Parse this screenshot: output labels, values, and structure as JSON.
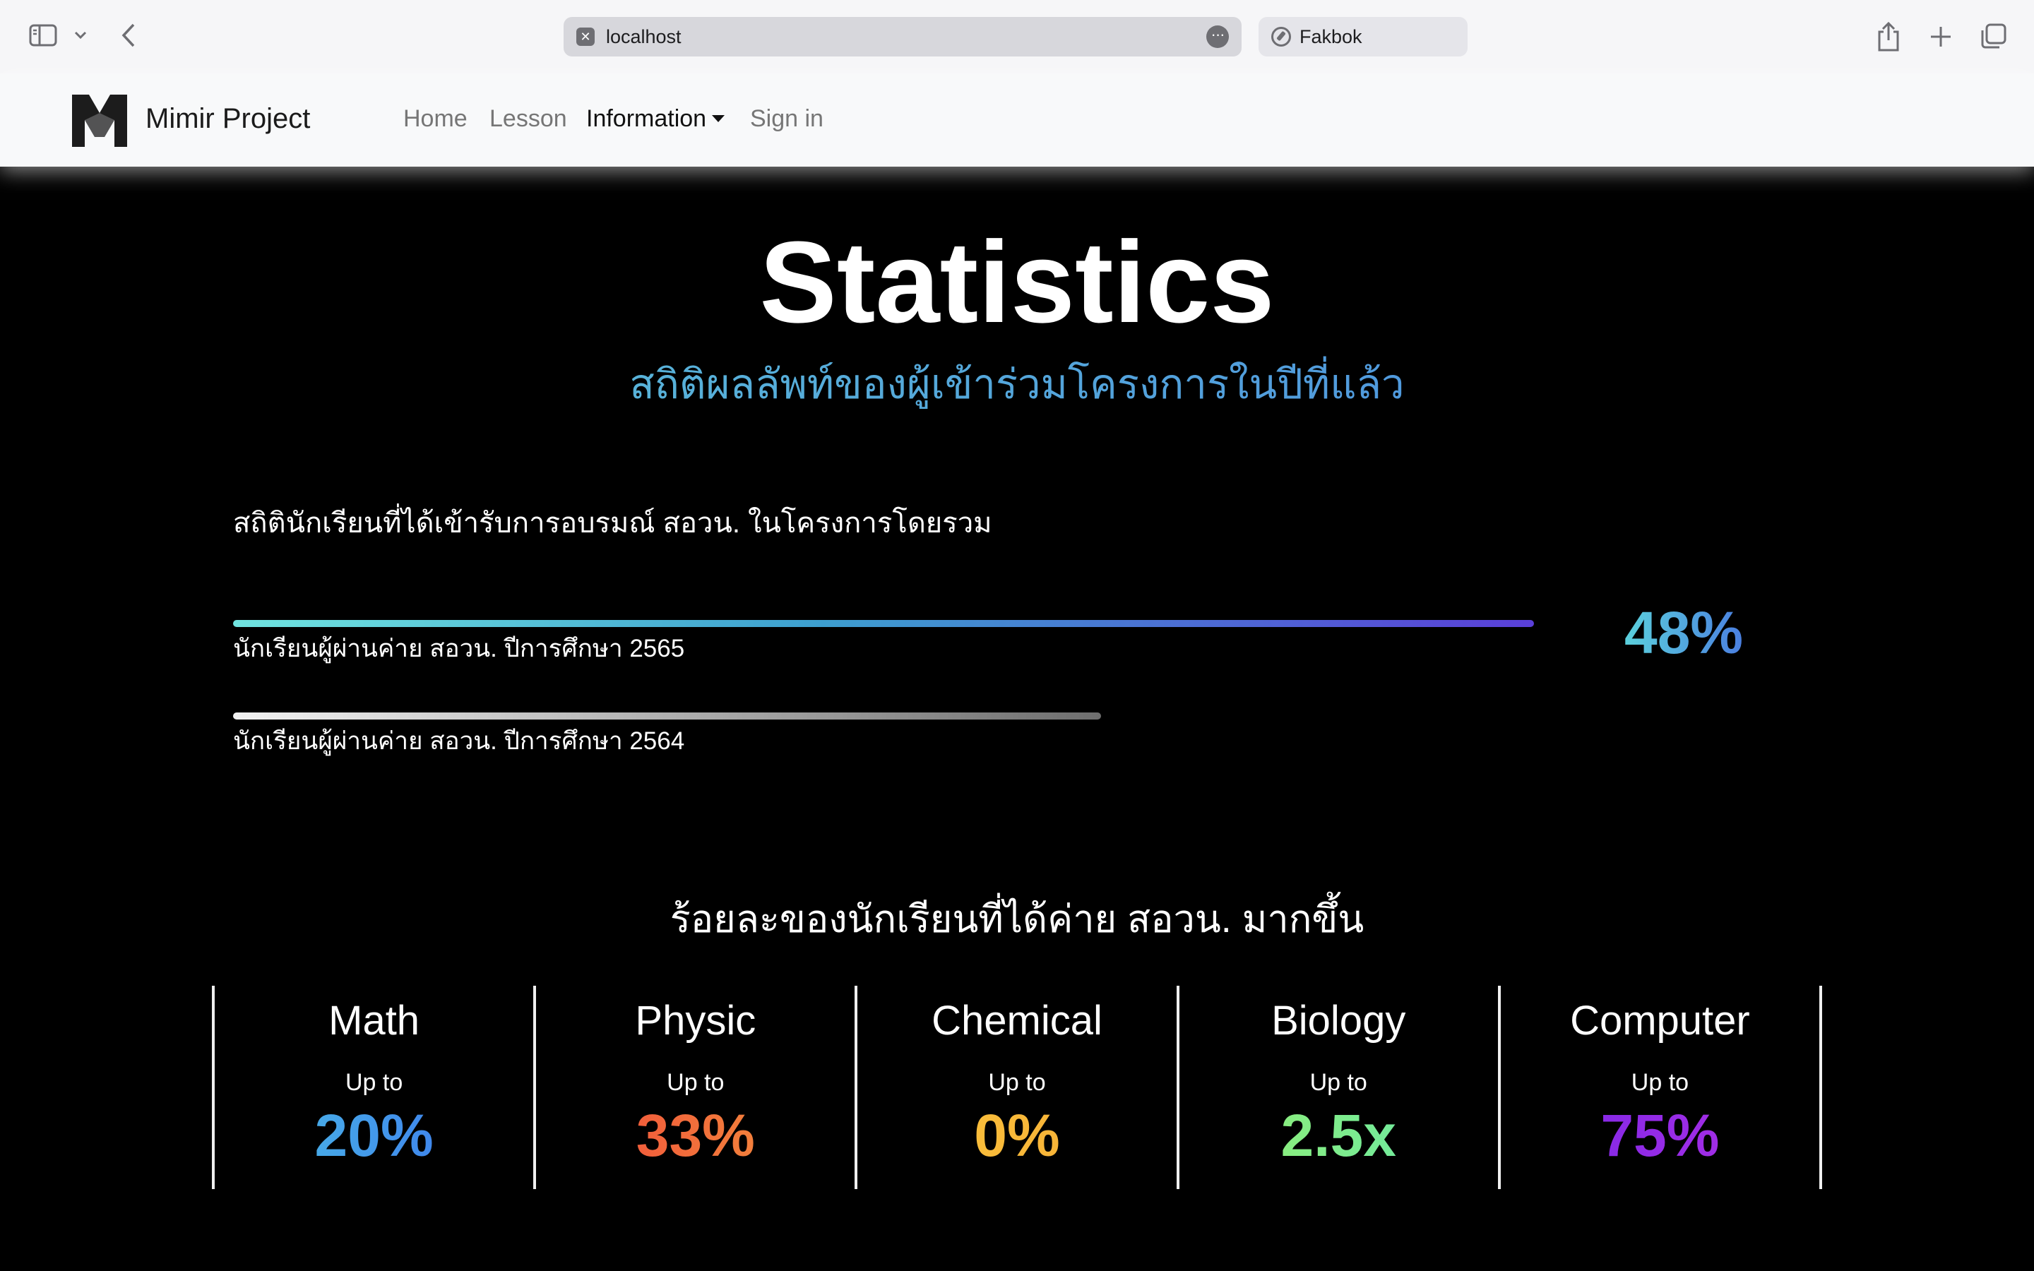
{
  "browser": {
    "url": "localhost",
    "second_tab_label": "Fakbok"
  },
  "navbar": {
    "brand": "Mimir Project",
    "links": [
      {
        "label": "Home"
      },
      {
        "label": "Lesson"
      },
      {
        "label": "Information",
        "active": true,
        "dropdown": true
      },
      {
        "label": "Sign in"
      }
    ]
  },
  "page": {
    "title": "Statistics",
    "subtitle": "สถิติผลลัพท์ของผู้เข้าร่วมโครงการในปีที่แล้ว",
    "section_heading": "สถิตินักเรียนที่ได้เข้ารับการอบรมณ์ สอวน. ในโครงการโดยรวม",
    "bars": [
      {
        "label": "นักเรียนผู้ผ่านค่าย สอวน. ปีการศึกษา 2565",
        "fill_fraction": 1.0
      },
      {
        "label": "นักเรียนผู้ผ่านค่าย สอวน. ปีการศึกษา 2564",
        "fill_fraction": 0.667
      }
    ],
    "bar_percent": "48%",
    "compare_heading": "ร้อยละของนักเรียนที่ได้ค่าย สอวน. มากขึ้น",
    "subjects": [
      {
        "name": "Math",
        "prefix": "Up to",
        "value": "20%",
        "color": "#3a8ef0"
      },
      {
        "name": "Physic",
        "prefix": "Up to",
        "value": "33%",
        "color": "#f2613a"
      },
      {
        "name": "Chemical",
        "prefix": "Up to",
        "value": "0%",
        "color": "#fbbf3a"
      },
      {
        "name": "Biology",
        "prefix": "Up to",
        "value": "2.5x",
        "color": "#7df08c"
      },
      {
        "name": "Computer",
        "prefix": "Up to",
        "value": "75%",
        "color": "#9b2be6"
      }
    ]
  }
}
